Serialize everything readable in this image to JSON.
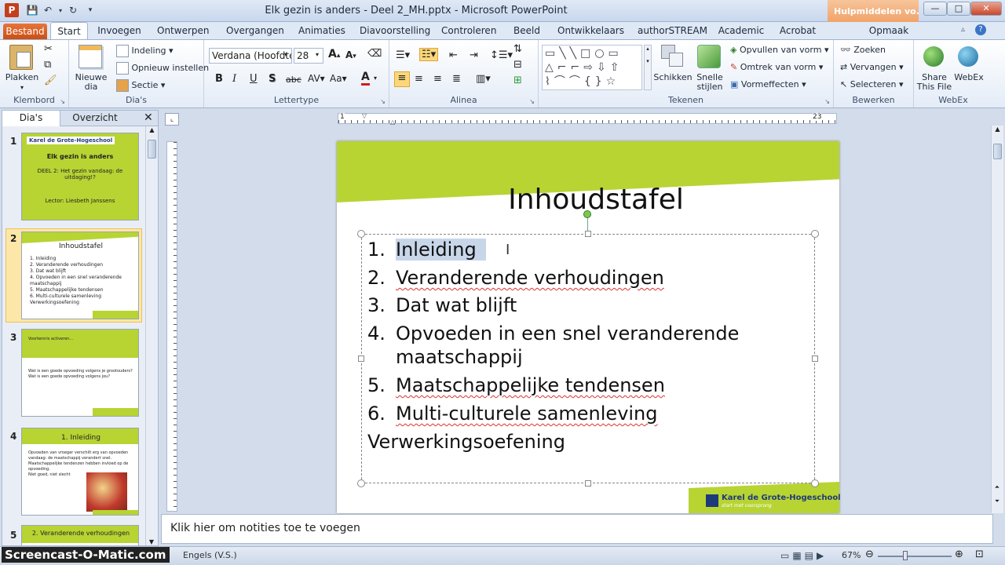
{
  "window": {
    "title": "Elk gezin is anders - Deel 2_MH.pptx - Microsoft PowerPoint",
    "context_tab": "Hulpmiddelen vo...",
    "minimize": "—",
    "maximize": "□",
    "close": "✕"
  },
  "tabs": [
    "Start",
    "Invoegen",
    "Ontwerpen",
    "Overgangen",
    "Animaties",
    "Diavoorstelling",
    "Controleren",
    "Beeld",
    "Ontwikkelaars",
    "authorSTREAM",
    "Academic",
    "Acrobat",
    "Opmaak"
  ],
  "file_tab": "Bestand",
  "ribbon": {
    "klembord": {
      "label": "Klembord",
      "paste": "Plakken"
    },
    "dias": {
      "label": "Dia's",
      "new": "Nieuwe dia",
      "layout": "Indeling",
      "reset": "Opnieuw instellen",
      "section": "Sectie"
    },
    "lettertype": {
      "label": "Lettertype",
      "font": "Verdana (Hoofdte",
      "size": "28"
    },
    "alinea": {
      "label": "Alinea"
    },
    "tekenen": {
      "label": "Tekenen",
      "arrange": "Schikken",
      "quick_styles": "Snelle stijlen",
      "fill": "Opvullen van vorm",
      "outline": "Omtrek van vorm",
      "effects": "Vormeffecten"
    },
    "bewerken": {
      "label": "Bewerken",
      "find": "Zoeken",
      "replace": "Vervangen",
      "select": "Selecteren"
    },
    "webex": {
      "label": "WebEx",
      "share": "Share This File",
      "webex": "WebEx"
    }
  },
  "left_panel": {
    "tab_slides": "Dia's",
    "tab_outline": "Overzicht",
    "slides": [
      {
        "num": "1",
        "title": "Elk gezin is anders",
        "sub": "DEEL 2: Het gezin vandaag: de uitdaging!?",
        "lector": "Lector: Liesbeth Janssens",
        "brand": "Karel de Grote-Hogeschool"
      },
      {
        "num": "2",
        "title": "Inhoudstafel",
        "items": [
          "1. Inleiding",
          "2. Veranderende verhoudingen",
          "3. Dat wat blijft",
          "4. Opvoeden in een snel veranderende maatschappij",
          "5. Maatschappelijke tendensen",
          "6. Multi-culturele samenleving",
          "Verwerkingsoefening"
        ]
      },
      {
        "num": "3",
        "title": "Voorkennis activeren...",
        "items": [
          "Wat is een goede opvoeding volgens je grootouders?",
          "Wat is een goede opvoeding volgens jou?"
        ]
      },
      {
        "num": "4",
        "title": "1. Inleiding",
        "items": [
          "Opvoeden van vroeger verschilt erg van opvoeden vandaag: de maatschappij verandert snel.",
          "Maatschappelijke tendenzen hebben invloed op de opvoeding.",
          "Niet goed, niet slecht"
        ]
      },
      {
        "num": "5",
        "title": "2. Veranderende verhoudingen"
      }
    ]
  },
  "slide": {
    "title": "Inhoudstafel",
    "items": [
      {
        "num": "1.",
        "text": "Inleiding"
      },
      {
        "num": "2.",
        "text": "Veranderende verhoudingen"
      },
      {
        "num": "3.",
        "text": "Dat wat blijft"
      },
      {
        "num": "4.",
        "text": "Opvoeden in een snel veranderende",
        "text2": "maatschappij"
      },
      {
        "num": "5.",
        "text": "Maatschappelijke tendensen"
      },
      {
        "num": "6.",
        "text": "Multi-culturele samenleving"
      }
    ],
    "extra": "Verwerkingsoefening",
    "logo_text": "Karel de Grote-Hogeschool",
    "logo_sub": "start met voorsprong"
  },
  "ruler_labels": [
    "1",
    "23"
  ],
  "notes_placeholder": "Klik hier om notities toe te voegen",
  "status": {
    "language": "Engels (V.S.)",
    "zoom": "67%",
    "watermark": "Screencast-O-Matic.com"
  },
  "colors": {
    "accent_green": "#b7d433",
    "file_tab": "#d95b20",
    "ribbon_bg": "#e4ecf7"
  }
}
